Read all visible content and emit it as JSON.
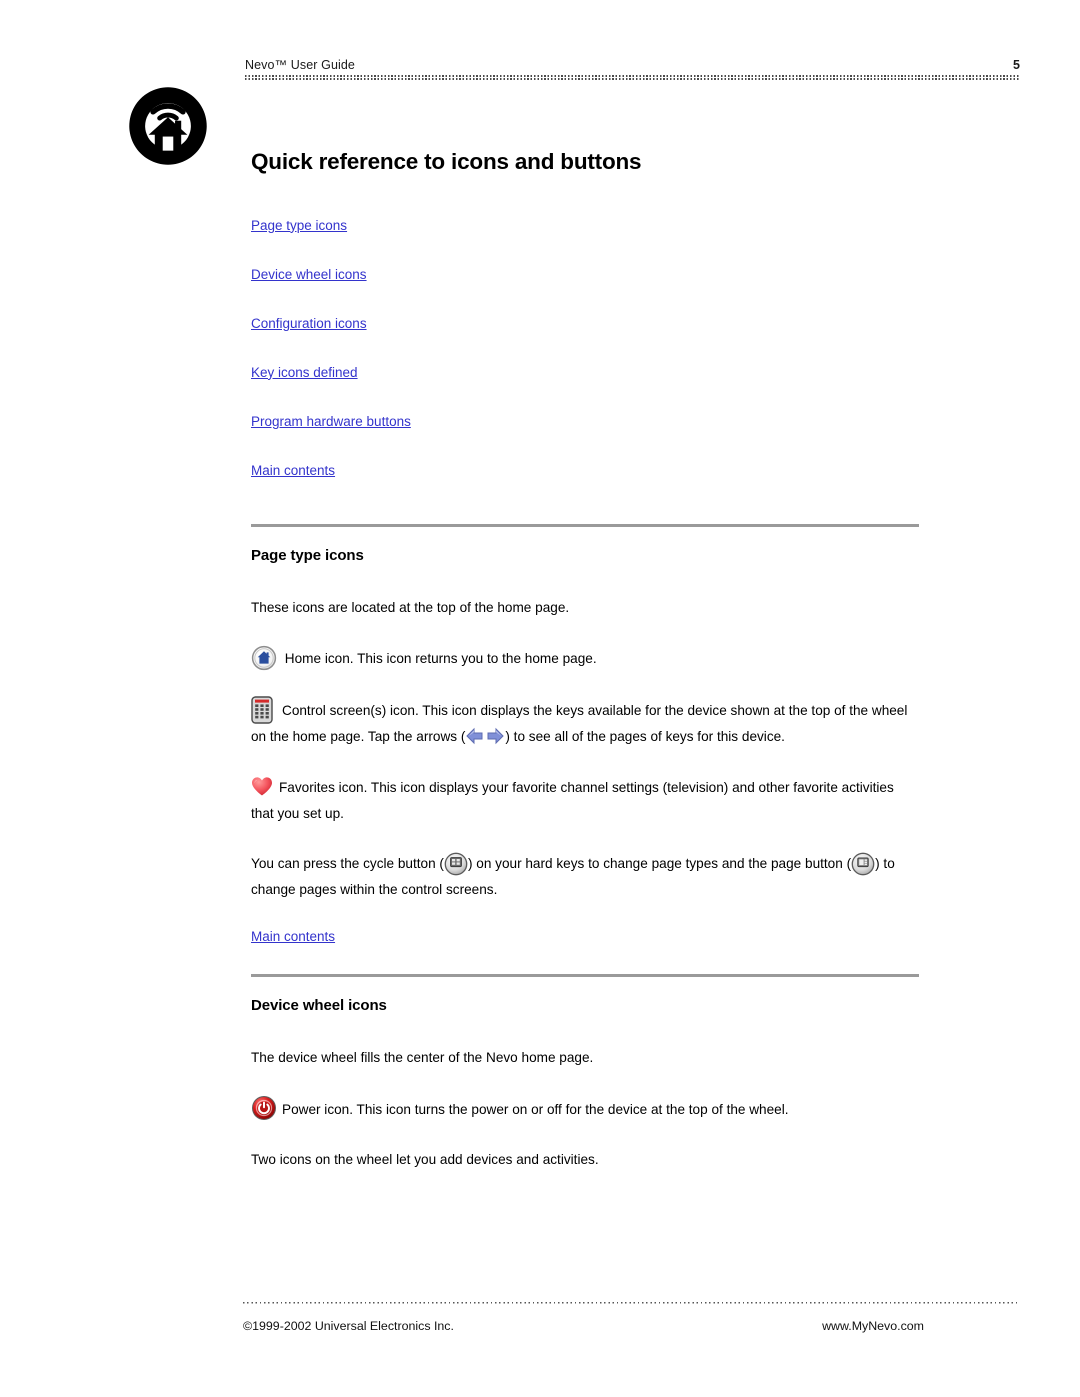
{
  "header": {
    "title": "Nevo™ User Guide",
    "page_number": "5"
  },
  "logo": {
    "name": "nevo-home-wifi-logo"
  },
  "doc": {
    "title": "Quick reference to icons and buttons"
  },
  "toc": {
    "items": [
      {
        "label": "Page type icons"
      },
      {
        "label": "Device wheel icons"
      },
      {
        "label": "Configuration icons"
      },
      {
        "label": "Key icons defined"
      },
      {
        "label": "Program hardware buttons"
      },
      {
        "label": "Main contents"
      }
    ]
  },
  "sections": [
    {
      "heading": "Page type icons",
      "intro": "These icons are located at the top of the home page.",
      "home_text": "Home icon. This icon returns you to the home page.",
      "control_text_a": "Control screen(s) icon. This icon displays the keys available for the device shown at the top of the wheel on the home page. Tap the arrows (",
      "control_text_b": ") to see all of the pages of keys for this device.",
      "favorites_text": "Favorites icon. This icon displays your favorite channel settings (television) and other favorite activities that you set up.",
      "cycle_text_a": "You can press the cycle button (",
      "cycle_text_b": ") on your hard keys to change page types and the page button (",
      "cycle_text_c": ") to change pages within the control screens.",
      "back_link": "Main contents"
    },
    {
      "heading": "Device wheel icons",
      "intro": "The device wheel fills the center of the Nevo home page.",
      "power_text": "Power icon. This icon turns the power on or off for the device at the top of the wheel.",
      "outro": "Two icons on the wheel let you add devices and activities."
    }
  ],
  "footer": {
    "copyright": "©1999-2002 Universal Electronics Inc.",
    "website": "www.MyNevo.com"
  },
  "colors": {
    "link": "#3333CC",
    "rule": "#9A9A9A",
    "power_red": "#C00000",
    "heart_red": "#F04B52",
    "home_blue": "#2B4F9E",
    "arrow_blue": "#8090D8"
  }
}
